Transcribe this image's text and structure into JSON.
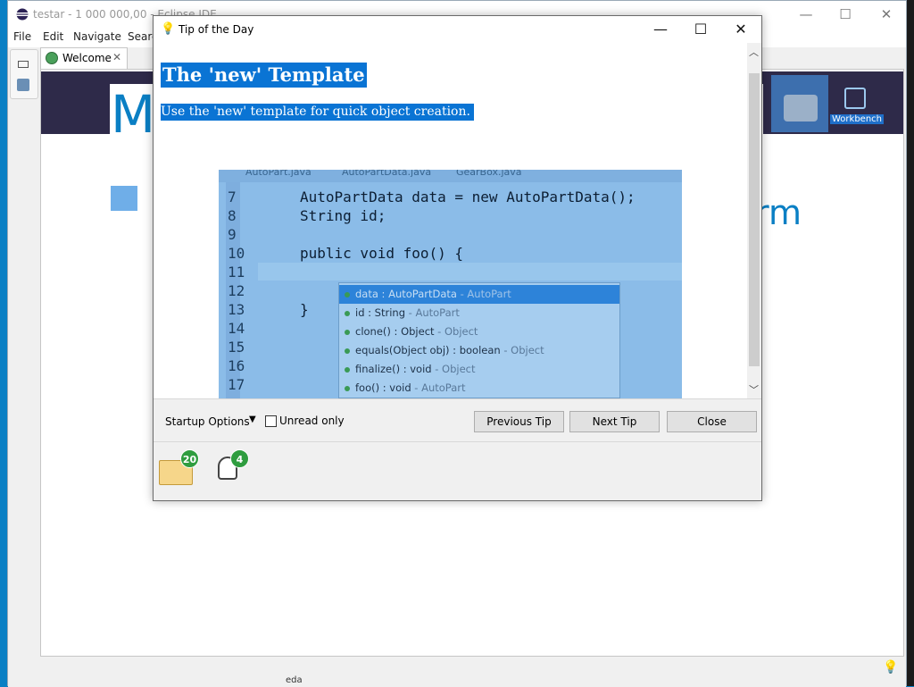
{
  "eclipse": {
    "title": "testar - 1 000 000,00 - Eclipse IDE",
    "menu": [
      "File",
      "Edit",
      "Navigate",
      "Searc"
    ],
    "welcome_tab": "Welcome",
    "workbench_label": "Workbench",
    "partial_heading_1": "M",
    "partial_heading_2": "rm",
    "status_text": "eda"
  },
  "dialog": {
    "title": "Tip of the Day",
    "tip_heading": "The 'new' Template",
    "tip_body": "Use the 'new' template for quick object creation.",
    "code_tabs": [
      "AutoPart.java",
      "AutoPartData.java",
      "GearBox.java"
    ],
    "code_lines": [
      {
        "n": "7",
        "code": "AutoPartData data = new AutoPartData();"
      },
      {
        "n": "8",
        "code": "String id;"
      },
      {
        "n": "9",
        "code": ""
      },
      {
        "n": "10",
        "code": "public void foo() {"
      },
      {
        "n": "11",
        "code": ""
      },
      {
        "n": "12",
        "code": ""
      },
      {
        "n": "13",
        "code": "}"
      },
      {
        "n": "14",
        "code": ""
      },
      {
        "n": "15",
        "code": ""
      },
      {
        "n": "16",
        "code": ""
      },
      {
        "n": "17",
        "code": ""
      }
    ],
    "autocomplete": [
      {
        "main": "data : AutoPartData",
        "qual": " - AutoPart",
        "selected": true
      },
      {
        "main": "id : String",
        "qual": " - AutoPart",
        "selected": false
      },
      {
        "main": "clone() : Object",
        "qual": " - Object",
        "selected": false
      },
      {
        "main": "equals(Object obj) : boolean",
        "qual": " - Object",
        "selected": false
      },
      {
        "main": "finalize() : void",
        "qual": " - Object",
        "selected": false
      },
      {
        "main": "foo() : void",
        "qual": " - AutoPart",
        "selected": false
      }
    ],
    "startup_options": "Startup Options",
    "unread_only": "Unread only",
    "unread_checked": false,
    "btn_previous": "Previous Tip",
    "btn_next": "Next Tip",
    "btn_close": "Close",
    "badge_open": "20",
    "badge_tips": "4"
  },
  "colors": {
    "accent": "#0a74d4",
    "banner": "#2e2a49",
    "badge": "#2f9d3f"
  }
}
